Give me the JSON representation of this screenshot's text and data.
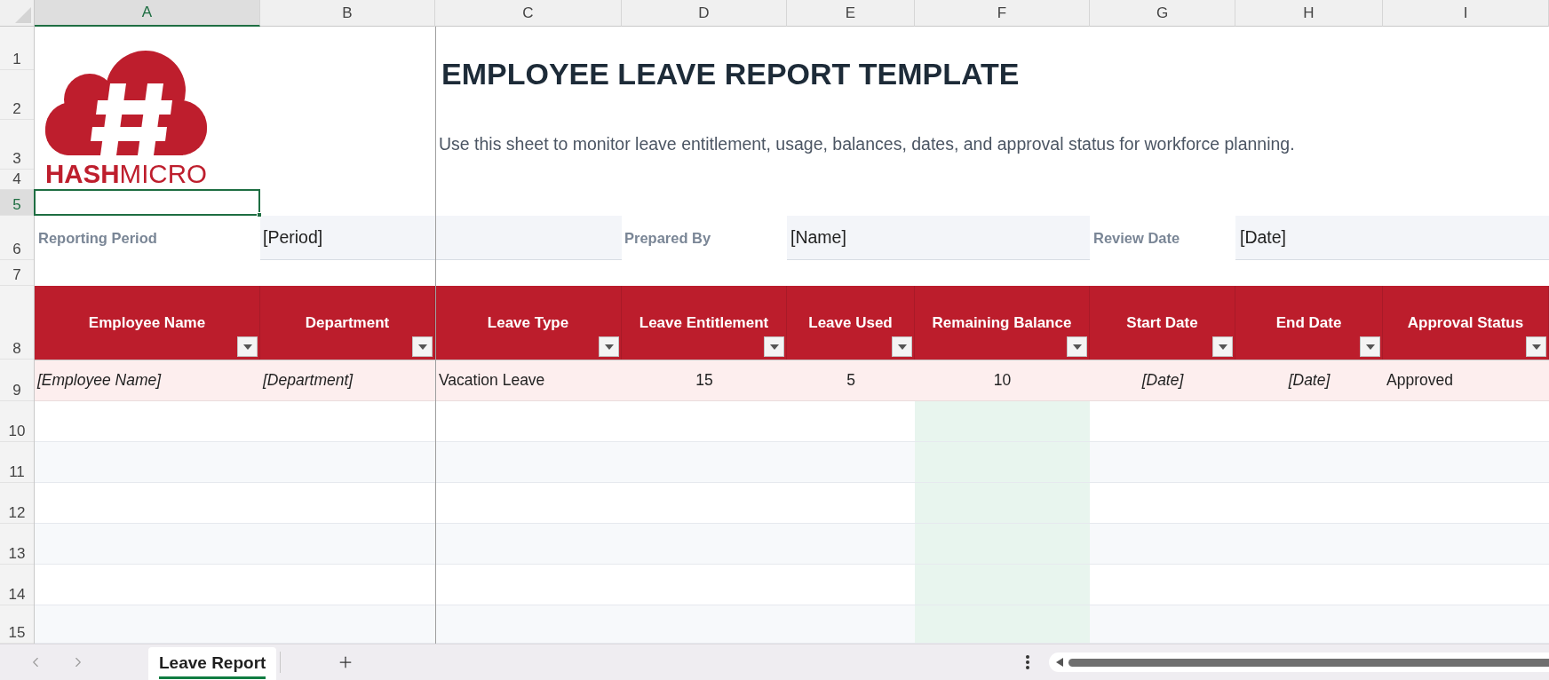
{
  "column_headers": [
    {
      "label": "A",
      "selected": true
    },
    {
      "label": "B",
      "selected": false
    },
    {
      "label": "C",
      "selected": false
    },
    {
      "label": "D",
      "selected": false
    },
    {
      "label": "E",
      "selected": false
    },
    {
      "label": "F",
      "selected": false
    },
    {
      "label": "G",
      "selected": false
    },
    {
      "label": "H",
      "selected": false
    },
    {
      "label": "I",
      "selected": false
    }
  ],
  "row_headers": [
    {
      "label": "1",
      "selected": false
    },
    {
      "label": "2",
      "selected": false
    },
    {
      "label": "3",
      "selected": false
    },
    {
      "label": "4",
      "selected": false
    },
    {
      "label": "5",
      "selected": true
    },
    {
      "label": "6",
      "selected": false
    },
    {
      "label": "7",
      "selected": false
    },
    {
      "label": "8",
      "selected": false
    },
    {
      "label": "9",
      "selected": false
    },
    {
      "label": "10",
      "selected": false
    },
    {
      "label": "11",
      "selected": false
    },
    {
      "label": "12",
      "selected": false
    },
    {
      "label": "13",
      "selected": false
    },
    {
      "label": "14",
      "selected": false
    },
    {
      "label": "15",
      "selected": false
    }
  ],
  "logo": {
    "text": "**HASH**MICRO"
  },
  "title": "EMPLOYEE LEAVE REPORT TEMPLATE",
  "subtitle": "Use this sheet to monitor leave entitlement, usage, balances, dates, and approval status for workforce planning.",
  "info_fields": [
    {
      "label": "Reporting Period",
      "value": "[Period]"
    },
    {
      "label": "Prepared By",
      "value": "[Name]"
    },
    {
      "label": "Review Date",
      "value": "[Date]"
    }
  ],
  "table": {
    "columns": [
      {
        "label": "Employee Name",
        "highlighted": false
      },
      {
        "label": "Department",
        "highlighted": false
      },
      {
        "label": "Leave Type",
        "highlighted": false
      },
      {
        "label": "Leave Entitlement",
        "highlighted": false
      },
      {
        "label": "Leave Used",
        "highlighted": false
      },
      {
        "label": "Remaining Balance",
        "highlighted": true
      },
      {
        "label": "Start Date",
        "highlighted": false
      },
      {
        "label": "End Date",
        "highlighted": false
      },
      {
        "label": "Approval Status",
        "highlighted": false
      }
    ],
    "rows": [
      {
        "cells": [
          {
            "text": "[Employee Name]",
            "kind": "placeholder"
          },
          {
            "text": "[Department]",
            "kind": "placeholder"
          },
          {
            "text": "Vacation Leave",
            "kind": "value"
          },
          {
            "text": "15",
            "kind": "value"
          },
          {
            "text": "5",
            "kind": "value"
          },
          {
            "text": "10",
            "kind": "value"
          },
          {
            "text": "[Date]",
            "kind": "placeholder"
          },
          {
            "text": "[Date]",
            "kind": "placeholder"
          },
          {
            "text": "Approved",
            "kind": "value"
          }
        ]
      }
    ]
  },
  "sheet_tabs": [
    {
      "label": "Leave Report",
      "selected": true
    }
  ]
}
